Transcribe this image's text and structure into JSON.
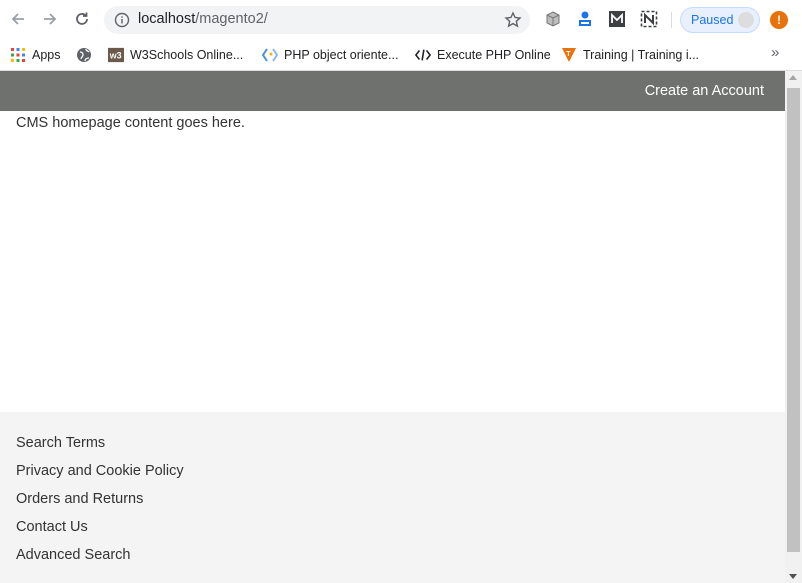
{
  "browser": {
    "url_host": "localhost",
    "url_path": "/magento2/",
    "profile_status": "Paused",
    "alert_symbol": "!"
  },
  "bookmarks": [
    {
      "label": "Apps",
      "icon": "apps-grid-icon"
    },
    {
      "label": "",
      "icon": "globe-icon"
    },
    {
      "label": "W3Schools Online...",
      "icon": "w3schools-icon"
    },
    {
      "label": "PHP object oriente...",
      "icon": "php-icon"
    },
    {
      "label": "Execute PHP Online",
      "icon": "code-icon"
    },
    {
      "label": "Training | Training i...",
      "icon": "training-icon"
    }
  ],
  "bookmarks_more": "»",
  "header": {
    "create_account": "Create an Account"
  },
  "main": {
    "content": "CMS homepage content goes here."
  },
  "footer": {
    "links": [
      "Search Terms",
      "Privacy and Cookie Policy",
      "Orders and Returns",
      "Contact Us",
      "Advanced Search"
    ]
  },
  "colors": {
    "header_bar": "#6e716e",
    "footer_bg": "#f4f4f4",
    "paused_blue": "#1a73e8",
    "alert_orange": "#e8710a"
  }
}
